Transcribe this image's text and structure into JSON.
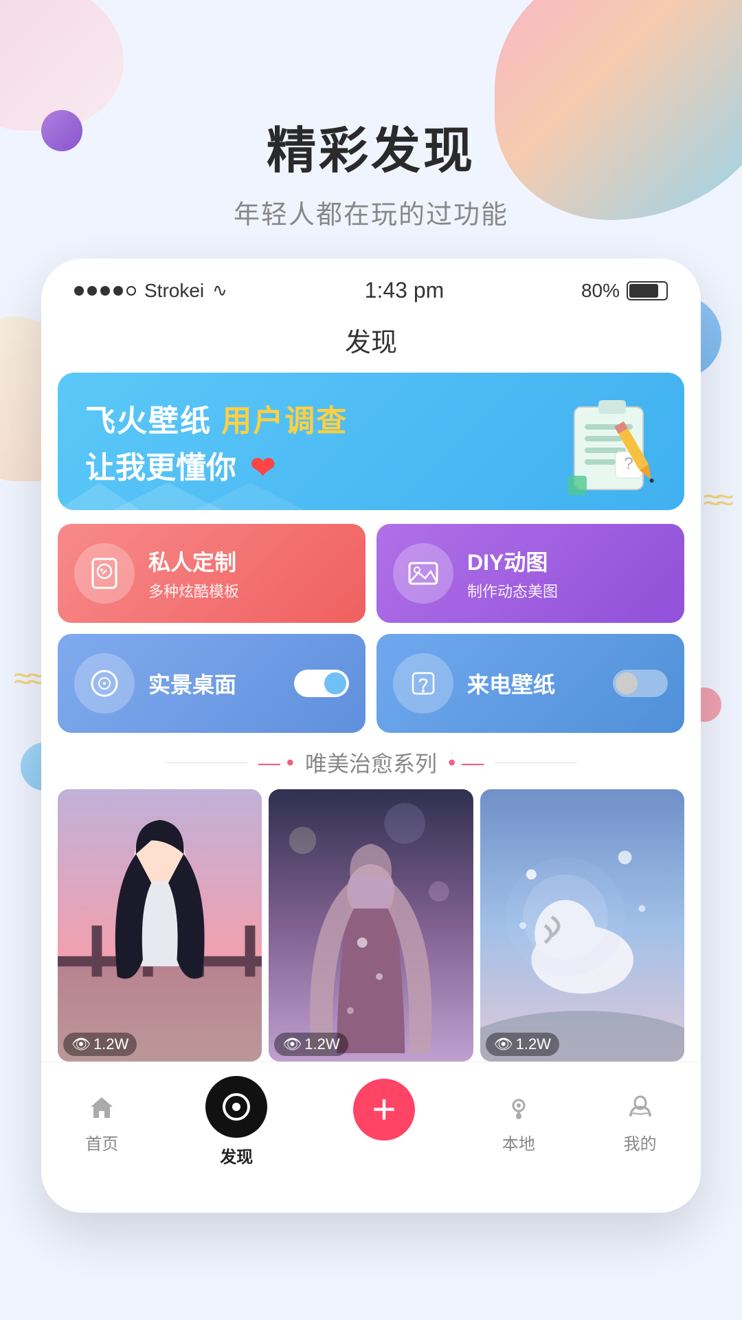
{
  "background": {
    "blobs": [
      "topright",
      "topleft",
      "midleft"
    ]
  },
  "hero": {
    "title": "精彩发现",
    "subtitle": "年轻人都在玩的过功能"
  },
  "statusBar": {
    "carrier": "Strokei",
    "wifi": "WiFi",
    "time": "1:43 pm",
    "battery": "80%"
  },
  "navTitle": "发现",
  "banner": {
    "line1_normal": "飞火壁纸 ",
    "line1_highlight": "用户调查",
    "line2": "让我更懂你",
    "heart": "❤"
  },
  "features": [
    {
      "id": "custom",
      "name": "私人定制",
      "desc": "多种炫酷模板",
      "icon": "📱",
      "color": "pink",
      "toggle": false
    },
    {
      "id": "diy",
      "name": "DIY动图",
      "desc": "制作动态美图",
      "icon": "🖼",
      "color": "purple",
      "toggle": false
    },
    {
      "id": "desktop",
      "name": "实景桌面",
      "icon": "📷",
      "color": "blue-light",
      "toggle": true,
      "toggleState": "on"
    },
    {
      "id": "ringtone",
      "name": "来电壁纸",
      "icon": "📞",
      "color": "blue-mid",
      "toggle": true,
      "toggleState": "off"
    }
  ],
  "series": {
    "title": "唯美治愈系列",
    "items": [
      {
        "id": 1,
        "views": "1.2W"
      },
      {
        "id": 2,
        "views": "1.2W"
      },
      {
        "id": 3,
        "views": "1.2W"
      }
    ]
  },
  "bottomNav": [
    {
      "id": "home",
      "label": "首页",
      "icon": "⌂",
      "active": false
    },
    {
      "id": "discover",
      "label": "发现",
      "icon": "●",
      "active": true
    },
    {
      "id": "add",
      "label": "",
      "icon": "+",
      "active": false,
      "special": "add"
    },
    {
      "id": "local",
      "label": "本地",
      "icon": "◎",
      "active": false
    },
    {
      "id": "mine",
      "label": "我的",
      "icon": "💬",
      "active": false
    }
  ]
}
